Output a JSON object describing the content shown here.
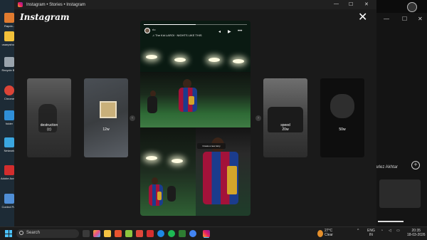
{
  "window": {
    "title": "Instagram • Stories • Instagram",
    "min": "—",
    "max": "☐",
    "close": "✕"
  },
  "brand": "Instagram",
  "close_label": "✕",
  "story_thumbs": [
    {
      "caption": "destruction",
      "caption2": "(c)"
    },
    {
      "caption": "12w",
      "caption2": ""
    },
    {
      "caption": "speed",
      "caption2": "20w"
    },
    {
      "caption": "50w",
      "caption2": ""
    }
  ],
  "active_story": {
    "user": "rlo",
    "song": "♫ The Kid LAROI · NIGHTS LIKE THIS",
    "sticker": "Create a new story",
    "progress": 0.5
  },
  "nav": {
    "prev": "‹",
    "next": "›"
  },
  "desktop_icons": [
    {
      "label": "Rapdo..",
      "color": "#e07b2f"
    },
    {
      "label": "usanpshot..",
      "color": "#f2c13a"
    },
    {
      "label": "Recycle Bin",
      "color": "#9aa4ad"
    },
    {
      "label": "Chrome",
      "color": "#db4437"
    },
    {
      "label": "folder",
      "color": "#2f8fd8"
    },
    {
      "label": "Network",
      "color": "#3ba7e0"
    },
    {
      "label": "Adobe Acrob..",
      "color": "#d22d2d"
    },
    {
      "label": "Control Pa..",
      "color": "#4f8ed6"
    }
  ],
  "bg_window": {
    "name": "Darlez Akhtar",
    "plus": "+"
  },
  "taskbar": {
    "search_placeholder": "Search",
    "weather_temp": "27°C",
    "weather_desc": "Clear",
    "lang_line1": "ENG",
    "lang_line2": "IN",
    "time": "20:35",
    "date": "18-03-2026"
  }
}
